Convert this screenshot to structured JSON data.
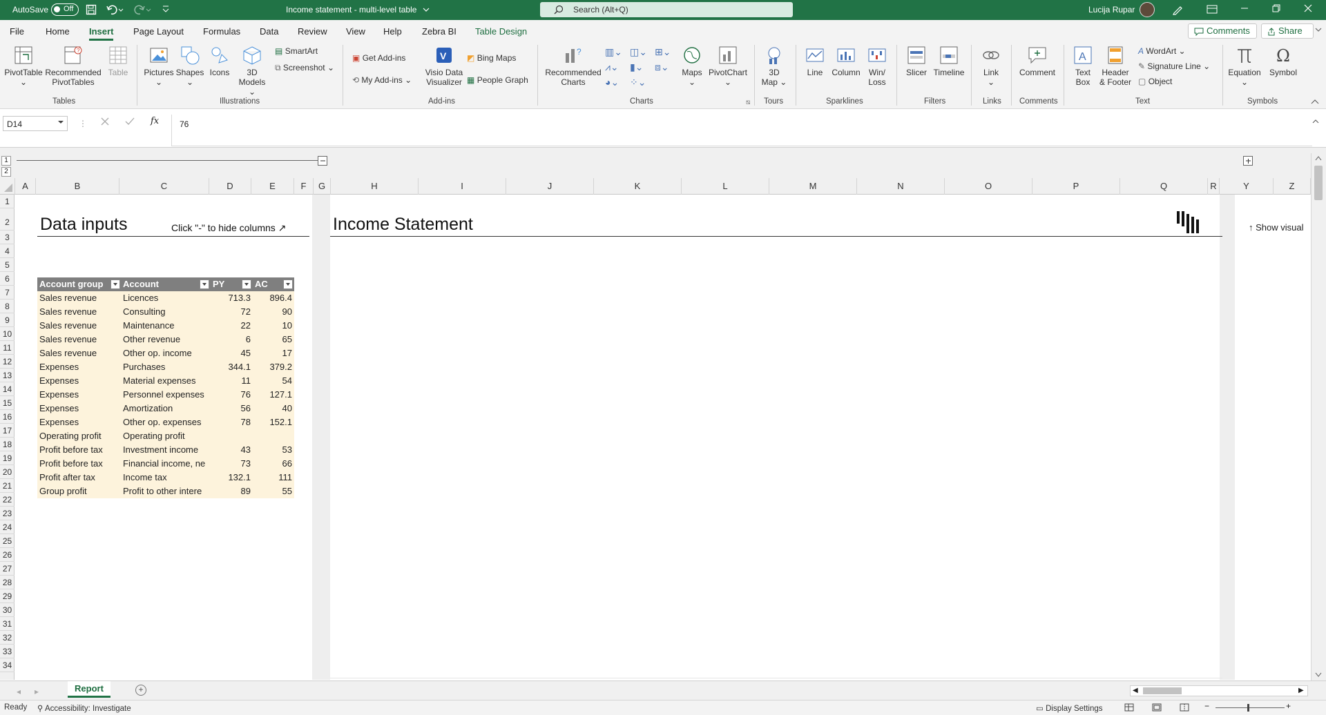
{
  "titlebar": {
    "autosave_label": "AutoSave",
    "autosave_state": "Off",
    "doc_title": "Income statement - multi-level table",
    "search_placeholder": "Search (Alt+Q)",
    "user_name": "Lucija Rupar"
  },
  "menu": {
    "tabs": [
      "File",
      "Home",
      "Insert",
      "Page Layout",
      "Formulas",
      "Data",
      "Review",
      "View",
      "Help",
      "Zebra BI",
      "Table Design"
    ],
    "active_tab": "Insert",
    "comments_label": "Comments",
    "share_label": "Share"
  },
  "ribbon": {
    "groups": {
      "tables": "Tables",
      "illustrations": "Illustrations",
      "addins": "Add-ins",
      "charts": "Charts",
      "tours": "Tours",
      "sparklines": "Sparklines",
      "filters": "Filters",
      "links": "Links",
      "comments": "Comments",
      "text": "Text",
      "symbols": "Symbols"
    },
    "buttons": {
      "pivottable": "PivotTable",
      "recommended_pivot_1": "Recommended",
      "recommended_pivot_2": "PivotTables",
      "table": "Table",
      "pictures": "Pictures",
      "shapes": "Shapes",
      "icons": "Icons",
      "models_1": "3D",
      "models_2": "Models",
      "smartart": "SmartArt",
      "screenshot": "Screenshot",
      "get_addins": "Get Add-ins",
      "my_addins": "My Add-ins",
      "visio_1": "Visio Data",
      "visio_2": "Visualizer",
      "bing_maps": "Bing Maps",
      "people_graph": "People Graph",
      "rec_charts_1": "Recommended",
      "rec_charts_2": "Charts",
      "maps": "Maps",
      "pivotchart": "PivotChart",
      "map3d_1": "3D",
      "map3d_2": "Map",
      "line": "Line",
      "column": "Column",
      "winloss_1": "Win/",
      "winloss_2": "Loss",
      "slicer": "Slicer",
      "timeline": "Timeline",
      "link": "Link",
      "comment": "Comment",
      "textbox_1": "Text",
      "textbox_2": "Box",
      "header_1": "Header",
      "header_2": "& Footer",
      "wordart": "WordArt",
      "signature": "Signature Line",
      "object": "Object",
      "equation": "Equation",
      "symbol": "Symbol"
    }
  },
  "formula_bar": {
    "name_box": "D14",
    "fx": "fx",
    "value": "76"
  },
  "outline_levels": [
    "1",
    "2"
  ],
  "columns": [
    "A",
    "B",
    "C",
    "D",
    "E",
    "F",
    "G",
    "H",
    "I",
    "J",
    "K",
    "L",
    "M",
    "N",
    "O",
    "P",
    "Q",
    "R",
    "Y",
    "Z"
  ],
  "rows": [
    "1",
    "2",
    "3",
    "4",
    "5",
    "6",
    "7",
    "8",
    "9",
    "10",
    "11",
    "12",
    "13",
    "14",
    "15",
    "16",
    "17",
    "18",
    "19",
    "20",
    "21",
    "22",
    "23",
    "24",
    "25",
    "26",
    "27",
    "28",
    "29",
    "30",
    "31",
    "32",
    "33",
    "34"
  ],
  "sheet": {
    "data_inputs_title": "Data inputs",
    "hide_hint": "Click \"-\" to hide columns ↗",
    "report_title": "Income Statement",
    "show_visual": "Show visual",
    "table_headers": [
      "Account group",
      "Account",
      "PY",
      "AC"
    ],
    "table_rows": [
      [
        "Sales revenue",
        "Licences",
        "713.3",
        "896.4"
      ],
      [
        "Sales revenue",
        "Consulting",
        "72",
        "90"
      ],
      [
        "Sales revenue",
        "Maintenance",
        "22",
        "10"
      ],
      [
        "Sales revenue",
        "Other revenue",
        "6",
        "65"
      ],
      [
        "Sales revenue",
        "Other op. income",
        "45",
        "17"
      ],
      [
        "Expenses",
        "Purchases",
        "344.1",
        "379.2"
      ],
      [
        "Expenses",
        "Material expenses",
        "11",
        "54"
      ],
      [
        "Expenses",
        "Personnel expenses",
        "76",
        "127.1"
      ],
      [
        "Expenses",
        "Amortization",
        "56",
        "40"
      ],
      [
        "Expenses",
        "Other op. expenses",
        "78",
        "152.1"
      ],
      [
        "Operating profit",
        "Operating profit",
        "",
        ""
      ],
      [
        "Profit before tax",
        "Investment income",
        "43",
        "53"
      ],
      [
        "Profit before tax",
        "Financial income, ne",
        "73",
        "66"
      ],
      [
        "Profit after tax",
        "Income tax",
        "132.1",
        "111"
      ],
      [
        "Group profit",
        "Profit to other intere",
        "89",
        "55"
      ]
    ]
  },
  "sheet_tabs": [
    "Report"
  ],
  "status": {
    "ready": "Ready",
    "accessibility": "Accessibility: Investigate",
    "display_settings": "Display Settings"
  },
  "colors": {
    "excel_green": "#217346",
    "table_header": "#7f7f7f",
    "table_row": "#fdf3dc"
  }
}
